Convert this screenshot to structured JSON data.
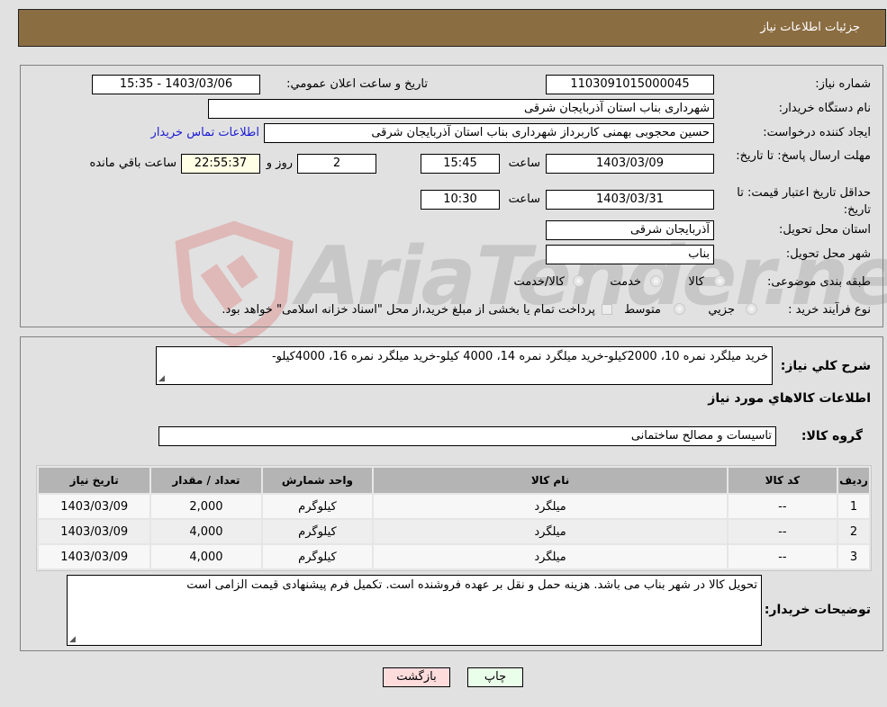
{
  "header": {
    "title": "جزئیات اطلاعات نیاز"
  },
  "details": {
    "need_number_label": "شماره نیاز:",
    "need_number": "1103091015000045",
    "announce_label": "تاريخ و ساعت اعلان عمومي:",
    "announce_value": "1403/03/06 - 15:35",
    "buyer_org_label": "نام دستگاه خریدار:",
    "buyer_org": "شهرداری بناب استان آذربایجان شرقی",
    "creator_label": "ایجاد کننده درخواست:",
    "creator": "حسین محجوبی بهمنی کاربرداز شهرداری بناب استان آذربایجان شرقی",
    "contact_link": "اطلاعات تماس خریدار",
    "deadline_label": "مهلت ارسال پاسخ: تا تاریخ:",
    "deadline_date": "1403/03/09",
    "time_label": "ساعت",
    "deadline_time": "15:45",
    "days_value": "2",
    "days_label": "روز و",
    "remaining_time": "22:55:37",
    "remaining_label": "ساعت باقي مانده",
    "validity_label": "حداقل تاریخ اعتبار قیمت: تا تاریخ:",
    "validity_date": "1403/03/31",
    "validity_time": "10:30",
    "province_label": "استان محل تحویل:",
    "province": "آذربایجان شرقی",
    "city_label": "شهر محل تحویل:",
    "city": "بناب",
    "category_label": "طبقه بندی موضوعی:",
    "category_options": [
      "کالا",
      "خدمت",
      "کالا/خدمت"
    ],
    "process_label": "نوع فرآیند خرید :",
    "process_options": [
      "جزيي",
      "متوسط"
    ],
    "payment_note": "پرداخت تمام یا بخشی از مبلغ خرید،از محل \"اسناد خزانه اسلامی\" خواهد بود."
  },
  "description": {
    "label": "شرح كلي نياز:",
    "value": "خرید میلگرد نمره 10، 2000کیلو-خرید میلگرد نمره 14، 4000 کیلو-خرید میلگرد نمره 16، 4000کیلو-"
  },
  "goods_section_title": "اطلاعات كالاهاي مورد نياز",
  "goods_group": {
    "label": "گروه کالا:",
    "value": "تاسیسات و مصالح ساختمانی"
  },
  "table": {
    "headers": [
      "ردیف",
      "کد کالا",
      "نام کالا",
      "واحد شمارش",
      "تعداد / مقدار",
      "تاریخ نیاز"
    ],
    "rows": [
      [
        "1",
        "--",
        "میلگرد",
        "کیلوگرم",
        "2,000",
        "1403/03/09"
      ],
      [
        "2",
        "--",
        "میلگرد",
        "کیلوگرم",
        "4,000",
        "1403/03/09"
      ],
      [
        "3",
        "--",
        "میلگرد",
        "کیلوگرم",
        "4,000",
        "1403/03/09"
      ]
    ]
  },
  "buyer_notes": {
    "label": "توضیحات خریدار:",
    "value": "تحویل کالا در شهر بناب می باشد. هزینه حمل و نقل بر عهده فروشنده است. تکمیل فرم پیشنهادی قیمت الزامی است"
  },
  "buttons": {
    "print": "چاپ",
    "back": "بازگشت"
  },
  "colors": {
    "header_bg": "#8b6d42",
    "print_bg": "#eaffea",
    "back_bg": "#ffdcdc",
    "link": "#1a1ad6"
  },
  "watermark": "AriaTender.neT"
}
